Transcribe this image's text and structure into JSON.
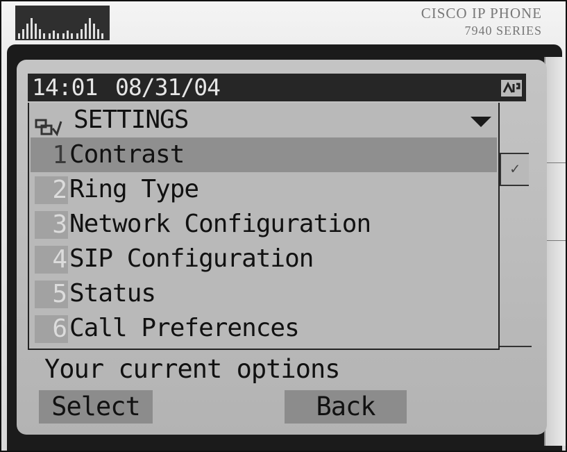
{
  "device": {
    "brand_line1": "CISCO IP PHONE",
    "brand_line2": "7940 SERIES"
  },
  "status_bar": {
    "time": "14:01",
    "date": "08/31/04",
    "line_icon": "line-status-icon"
  },
  "menu": {
    "title": "SETTINGS",
    "title_icon": "settings-icon",
    "scroll_icon": "scroll-down-arrow-icon",
    "items": [
      {
        "number": "1",
        "label": "Contrast",
        "selected": true
      },
      {
        "number": "2",
        "label": "Ring Type",
        "selected": false
      },
      {
        "number": "3",
        "label": "Network Configuration",
        "selected": false
      },
      {
        "number": "4",
        "label": "SIP Configuration",
        "selected": false
      },
      {
        "number": "5",
        "label": "Status",
        "selected": false
      },
      {
        "number": "6",
        "label": "Call Preferences",
        "selected": false
      }
    ]
  },
  "prompt": "Your current options",
  "softkeys": {
    "select": "Select",
    "back": "Back"
  },
  "colors": {
    "lcd_background": "#bdbdbd",
    "status_bar": "#262626",
    "selected_row": "#8f8f8f",
    "softkey": "#8c8c8c",
    "bezel": "#1b1b1b"
  }
}
